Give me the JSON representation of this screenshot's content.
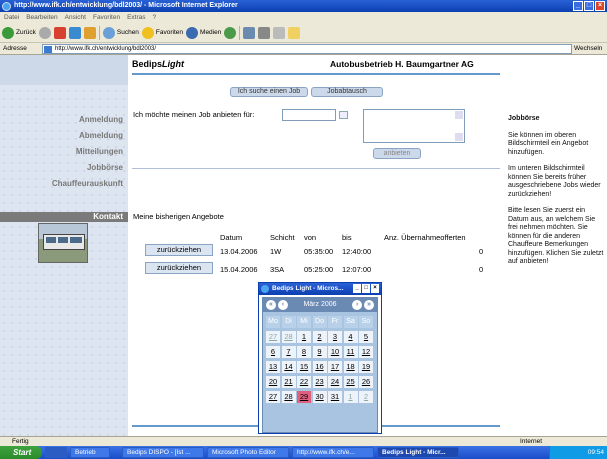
{
  "window": {
    "title": "http://www.ifk.ch/entwicklung/bdl2003/ - Microsoft Internet Explorer"
  },
  "menu": [
    "Datei",
    "Bearbeiten",
    "Ansicht",
    "Favoriten",
    "Extras",
    "?"
  ],
  "toolbar": {
    "back": "Zurück",
    "search": "Suchen",
    "favorites": "Favoriten",
    "media": "Medien"
  },
  "address": {
    "label": "Adresse",
    "url": "http://www.ifk.ch/entwicklung/bdl2003/",
    "go": "Wechseln zu",
    "links": "Links"
  },
  "header": {
    "brand_a": "Bedips",
    "brand_b": "Light",
    "company": "Autobusbetrieb H. Baumgartner AG"
  },
  "nav": [
    "Anmeldung",
    "Abmeldung",
    "Mitteilungen",
    "Jobbörse",
    "Chauffeurauskunft",
    "Kontakt"
  ],
  "tabs": [
    "Ich suche einen Job",
    "Jobabtausch"
  ],
  "offer": {
    "label": "Ich möchte meinen Job anbieten für:",
    "submit": "anbieten"
  },
  "offers": {
    "title": "Meine bisherigen Angebote",
    "columns": [
      "Datum",
      "Schicht",
      "von",
      "bis",
      "Anz. Übernahmeofferten"
    ],
    "rows": [
      {
        "action": "zurückziehen",
        "date": "13.04.2006",
        "shift": "1W",
        "from": "05:35:00",
        "to": "12:40:00",
        "count": "0"
      },
      {
        "action": "zurückziehen",
        "date": "15.04.2006",
        "shift": "3SA",
        "from": "05:25:00",
        "to": "12:07:00",
        "count": "0"
      }
    ]
  },
  "popup": {
    "title": "Bedips Light - Micros...",
    "month": "März 2006",
    "weekdays": [
      "Mo",
      "Di",
      "Mi",
      "Do",
      "Fr",
      "Sa",
      "So"
    ],
    "weeks": [
      [
        "27",
        "28",
        "1",
        "2",
        "3",
        "4",
        "5"
      ],
      [
        "6",
        "7",
        "8",
        "9",
        "10",
        "11",
        "12"
      ],
      [
        "13",
        "14",
        "15",
        "16",
        "17",
        "18",
        "19"
      ],
      [
        "20",
        "21",
        "22",
        "23",
        "24",
        "25",
        "26"
      ],
      [
        "27",
        "28",
        "29",
        "30",
        "31",
        "1",
        "2"
      ]
    ],
    "today": "29"
  },
  "sidebar": {
    "title": "Jobbörse",
    "p1": "Sie können im oberen Bildschirmteil ein Angebot hinzufügen.",
    "p2": "Im unteren Bildschirmteil können Sie bereits früher ausgeschriebene Jobs wieder zurückziehen!",
    "p3": "Bitte lesen Sie zuerst ein Datum aus, an welchem Sie frei nehmen möchten. Sie können für die anderen Chauffeure Bemerkungen hinzufügen. Klichen Sie zuletzt auf anbieten!"
  },
  "status": {
    "text": "Fertig",
    "zone": "Internet"
  },
  "taskbar": {
    "start": "Start",
    "items": [
      "Betrieb",
      "Bedips DISPO - [Ist ...",
      "Microsoft Photo Editor",
      "http://www.ifk.ch/e...",
      "Bedips Light - Micr..."
    ],
    "clock": "09:54"
  },
  "colors": {
    "accent": "#6699cc",
    "xp_blue": "#0b3fb0",
    "today": "#e06080"
  }
}
